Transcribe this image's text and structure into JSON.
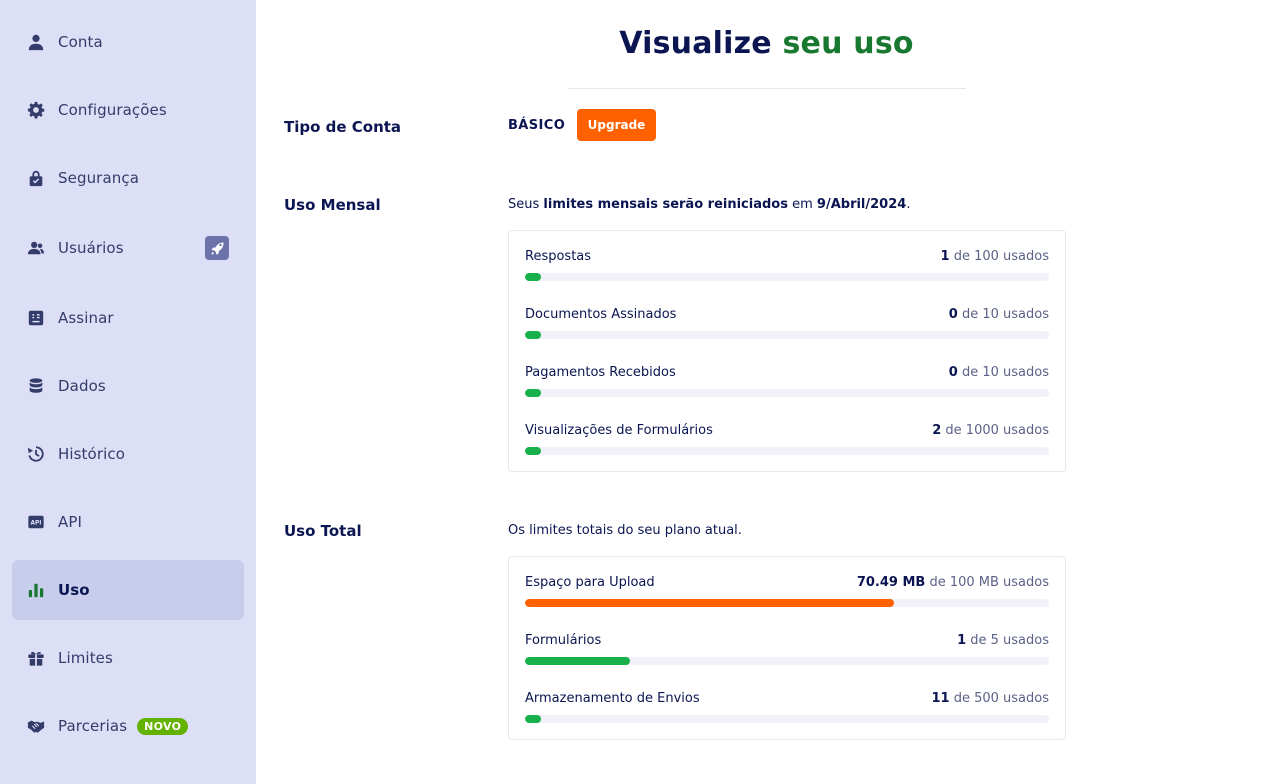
{
  "sidebar": {
    "items": [
      {
        "label": "Conta",
        "icon": "user-icon"
      },
      {
        "label": "Configurações",
        "icon": "gear-icon"
      },
      {
        "label": "Segurança",
        "icon": "lock-icon"
      },
      {
        "label": "Usuários",
        "icon": "users-icon"
      },
      {
        "label": "Assinar",
        "icon": "sign-document-icon"
      },
      {
        "label": "Dados",
        "icon": "database-icon"
      },
      {
        "label": "Histórico",
        "icon": "history-icon"
      },
      {
        "label": "API",
        "icon": "api-icon"
      },
      {
        "label": "Uso",
        "icon": "bar-chart-icon",
        "active": true
      },
      {
        "label": "Limites",
        "icon": "gift-icon"
      },
      {
        "label": "Parcerias",
        "icon": "handshake-icon",
        "badge": "NOVO"
      }
    ],
    "rocket_badge_icon": "rocket-icon"
  },
  "page": {
    "title_part1": "Visualize ",
    "title_part2": "seu uso"
  },
  "account": {
    "label": "Tipo de Conta",
    "plan": "BÁSICO",
    "upgrade_label": "Upgrade"
  },
  "monthly": {
    "label": "Uso Mensal",
    "desc_pre": "Seus ",
    "desc_bold": "limites mensais serão reiniciados",
    "desc_mid": " em ",
    "desc_date": "9/Abril/2024",
    "desc_end": ".",
    "meters": [
      {
        "name": "Respostas",
        "used": "1",
        "rest": " de 100 usados",
        "fraction": 0.01
      },
      {
        "name": "Documentos Assinados",
        "used": "0",
        "rest": " de 10 usados",
        "fraction": 0
      },
      {
        "name": "Pagamentos Recebidos",
        "used": "0",
        "rest": " de 10 usados",
        "fraction": 0
      },
      {
        "name": "Visualizações de Formulários",
        "used": "2",
        "rest": " de 1000 usados",
        "fraction": 0.002
      }
    ]
  },
  "total": {
    "label": "Uso Total",
    "desc": "Os limites totais do seu plano atual.",
    "meters": [
      {
        "name": "Espaço para Upload",
        "used": "70.49 MB",
        "rest": " de 100 MB usados",
        "fraction": 0.7049,
        "color": "#ff6100"
      },
      {
        "name": "Formulários",
        "used": "1",
        "rest": " de 5 usados",
        "fraction": 0.2
      },
      {
        "name": "Armazenamento de Envios",
        "used": "11",
        "rest": " de 500 usados",
        "fraction": 0.022
      }
    ]
  },
  "colors": {
    "accent_green": "#18782f",
    "bar_green": "#18b04a",
    "upgrade_orange": "#ff6100",
    "sidebar_bg": "#dcdff6",
    "novo_badge": "#64b200"
  }
}
